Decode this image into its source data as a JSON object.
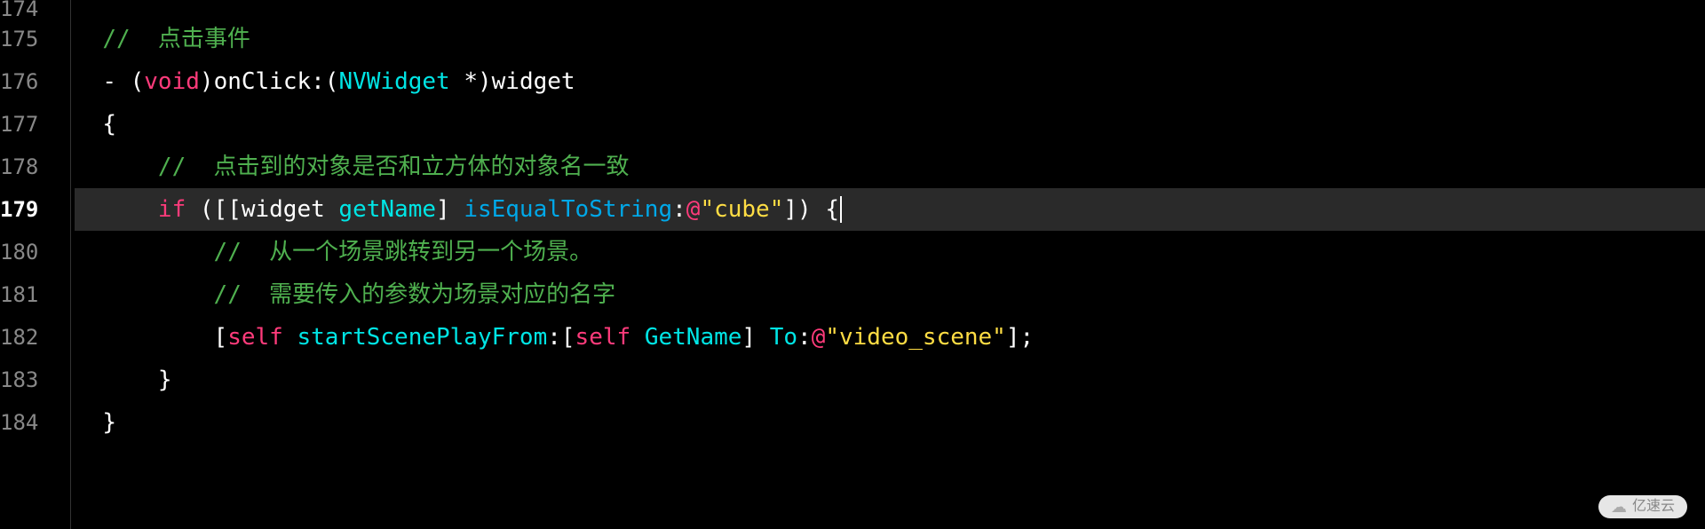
{
  "editor": {
    "current_line": 179,
    "lines": [
      {
        "num": "174",
        "current": false,
        "tokens": []
      },
      {
        "num": "175",
        "current": false,
        "tokens": [
          {
            "cls": "tk-plain",
            "text": "  "
          },
          {
            "cls": "tk-comment",
            "text": "//  点击事件"
          }
        ]
      },
      {
        "num": "176",
        "current": false,
        "tokens": [
          {
            "cls": "tk-plain",
            "text": "  "
          },
          {
            "cls": "tk-punct",
            "text": "- ("
          },
          {
            "cls": "tk-keyword",
            "text": "void"
          },
          {
            "cls": "tk-punct",
            "text": ")"
          },
          {
            "cls": "tk-plain",
            "text": "onClick:("
          },
          {
            "cls": "tk-type",
            "text": "NVWidget"
          },
          {
            "cls": "tk-plain",
            "text": " *)widget"
          }
        ]
      },
      {
        "num": "177",
        "current": false,
        "tokens": [
          {
            "cls": "tk-plain",
            "text": "  "
          },
          {
            "cls": "tk-punct",
            "text": "{"
          }
        ]
      },
      {
        "num": "178",
        "current": false,
        "tokens": [
          {
            "cls": "tk-plain",
            "text": "      "
          },
          {
            "cls": "tk-comment",
            "text": "//  点击到的对象是否和立方体的对象名一致"
          }
        ]
      },
      {
        "num": "179",
        "current": true,
        "tokens": [
          {
            "cls": "tk-plain",
            "text": "      "
          },
          {
            "cls": "tk-keyword",
            "text": "if"
          },
          {
            "cls": "tk-plain",
            "text": " ([[widget "
          },
          {
            "cls": "tk-type",
            "text": "getName"
          },
          {
            "cls": "tk-plain",
            "text": "] "
          },
          {
            "cls": "tk-method",
            "text": "isEqualToString"
          },
          {
            "cls": "tk-plain",
            "text": ":"
          },
          {
            "cls": "tk-selector",
            "text": "@"
          },
          {
            "cls": "tk-string",
            "text": "\"cube\""
          },
          {
            "cls": "tk-plain",
            "text": "]) {"
          }
        ]
      },
      {
        "num": "180",
        "current": false,
        "tokens": [
          {
            "cls": "tk-plain",
            "text": "          "
          },
          {
            "cls": "tk-comment",
            "text": "//  从一个场景跳转到另一个场景。"
          }
        ]
      },
      {
        "num": "181",
        "current": false,
        "tokens": [
          {
            "cls": "tk-plain",
            "text": "          "
          },
          {
            "cls": "tk-comment",
            "text": "//  需要传入的参数为场景对应的名字"
          }
        ]
      },
      {
        "num": "182",
        "current": false,
        "tokens": [
          {
            "cls": "tk-plain",
            "text": "          ["
          },
          {
            "cls": "tk-self",
            "text": "self"
          },
          {
            "cls": "tk-plain",
            "text": " "
          },
          {
            "cls": "tk-type",
            "text": "startScenePlayFrom"
          },
          {
            "cls": "tk-plain",
            "text": ":["
          },
          {
            "cls": "tk-self",
            "text": "self"
          },
          {
            "cls": "tk-plain",
            "text": " "
          },
          {
            "cls": "tk-type",
            "text": "GetName"
          },
          {
            "cls": "tk-plain",
            "text": "] "
          },
          {
            "cls": "tk-type",
            "text": "To"
          },
          {
            "cls": "tk-plain",
            "text": ":"
          },
          {
            "cls": "tk-selector",
            "text": "@"
          },
          {
            "cls": "tk-string",
            "text": "\"video_scene\""
          },
          {
            "cls": "tk-plain",
            "text": "];"
          }
        ]
      },
      {
        "num": "183",
        "current": false,
        "tokens": [
          {
            "cls": "tk-plain",
            "text": "      "
          },
          {
            "cls": "tk-punct",
            "text": "}"
          }
        ]
      },
      {
        "num": "184",
        "current": false,
        "tokens": [
          {
            "cls": "tk-plain",
            "text": "  "
          },
          {
            "cls": "tk-punct",
            "text": "}"
          }
        ]
      }
    ]
  },
  "watermark": {
    "text": "亿速云"
  }
}
